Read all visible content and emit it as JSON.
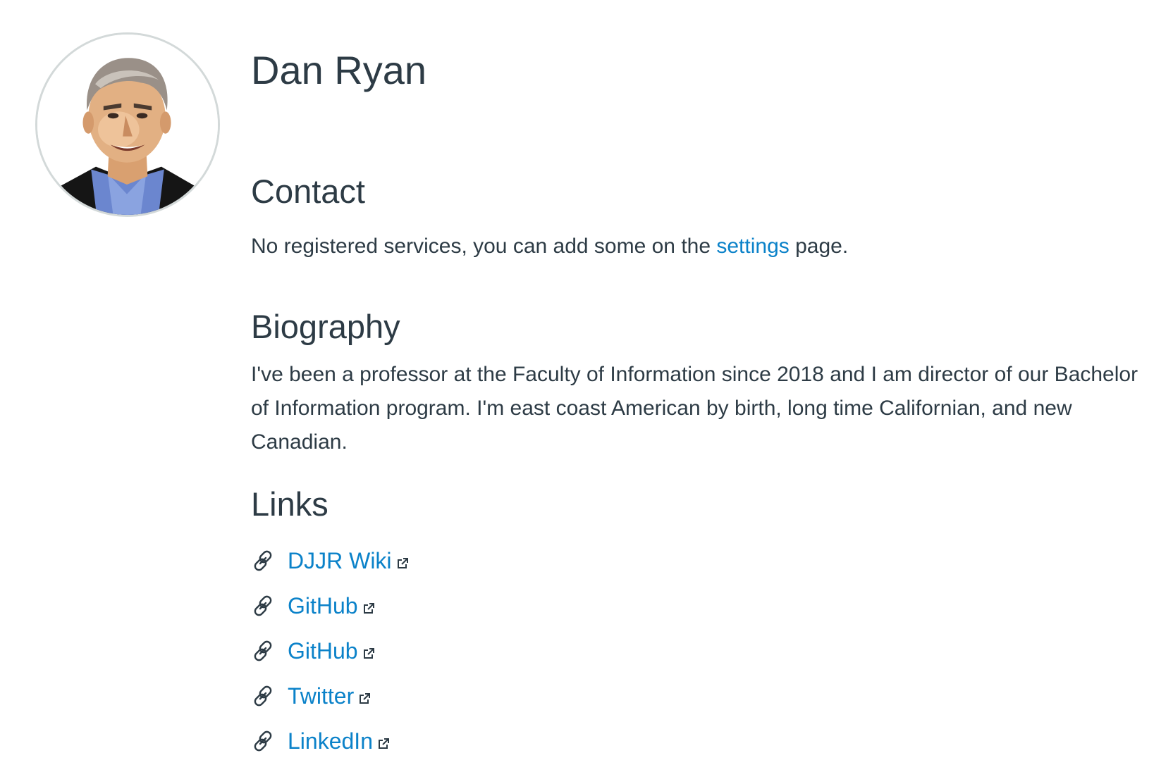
{
  "profile": {
    "name": "Dan Ryan",
    "avatar_alt": "avatar",
    "colors": {
      "text": "#2d3b45",
      "link": "#0b82c9",
      "avatar_border": "#d3d9d9"
    }
  },
  "contact": {
    "heading": "Contact",
    "text_before": "No registered services, you can add some on the ",
    "settings_link": "settings",
    "text_after": " page."
  },
  "biography": {
    "heading": "Biography",
    "text": "I've been a professor at the Faculty of Information since 2018 and I am director of our Bachelor of Information program. I'm east coast American by birth, long time Californian, and new Canadian."
  },
  "links": {
    "heading": "Links",
    "items": [
      {
        "label": "DJJR Wiki",
        "icon": "chain-link-icon",
        "external_icon": "external-link-icon"
      },
      {
        "label": "GitHub",
        "icon": "chain-link-icon",
        "external_icon": "external-link-icon"
      },
      {
        "label": "GitHub",
        "icon": "chain-link-icon",
        "external_icon": "external-link-icon"
      },
      {
        "label": "Twitter",
        "icon": "chain-link-icon",
        "external_icon": "external-link-icon"
      },
      {
        "label": "LinkedIn",
        "icon": "chain-link-icon",
        "external_icon": "external-link-icon"
      }
    ]
  }
}
